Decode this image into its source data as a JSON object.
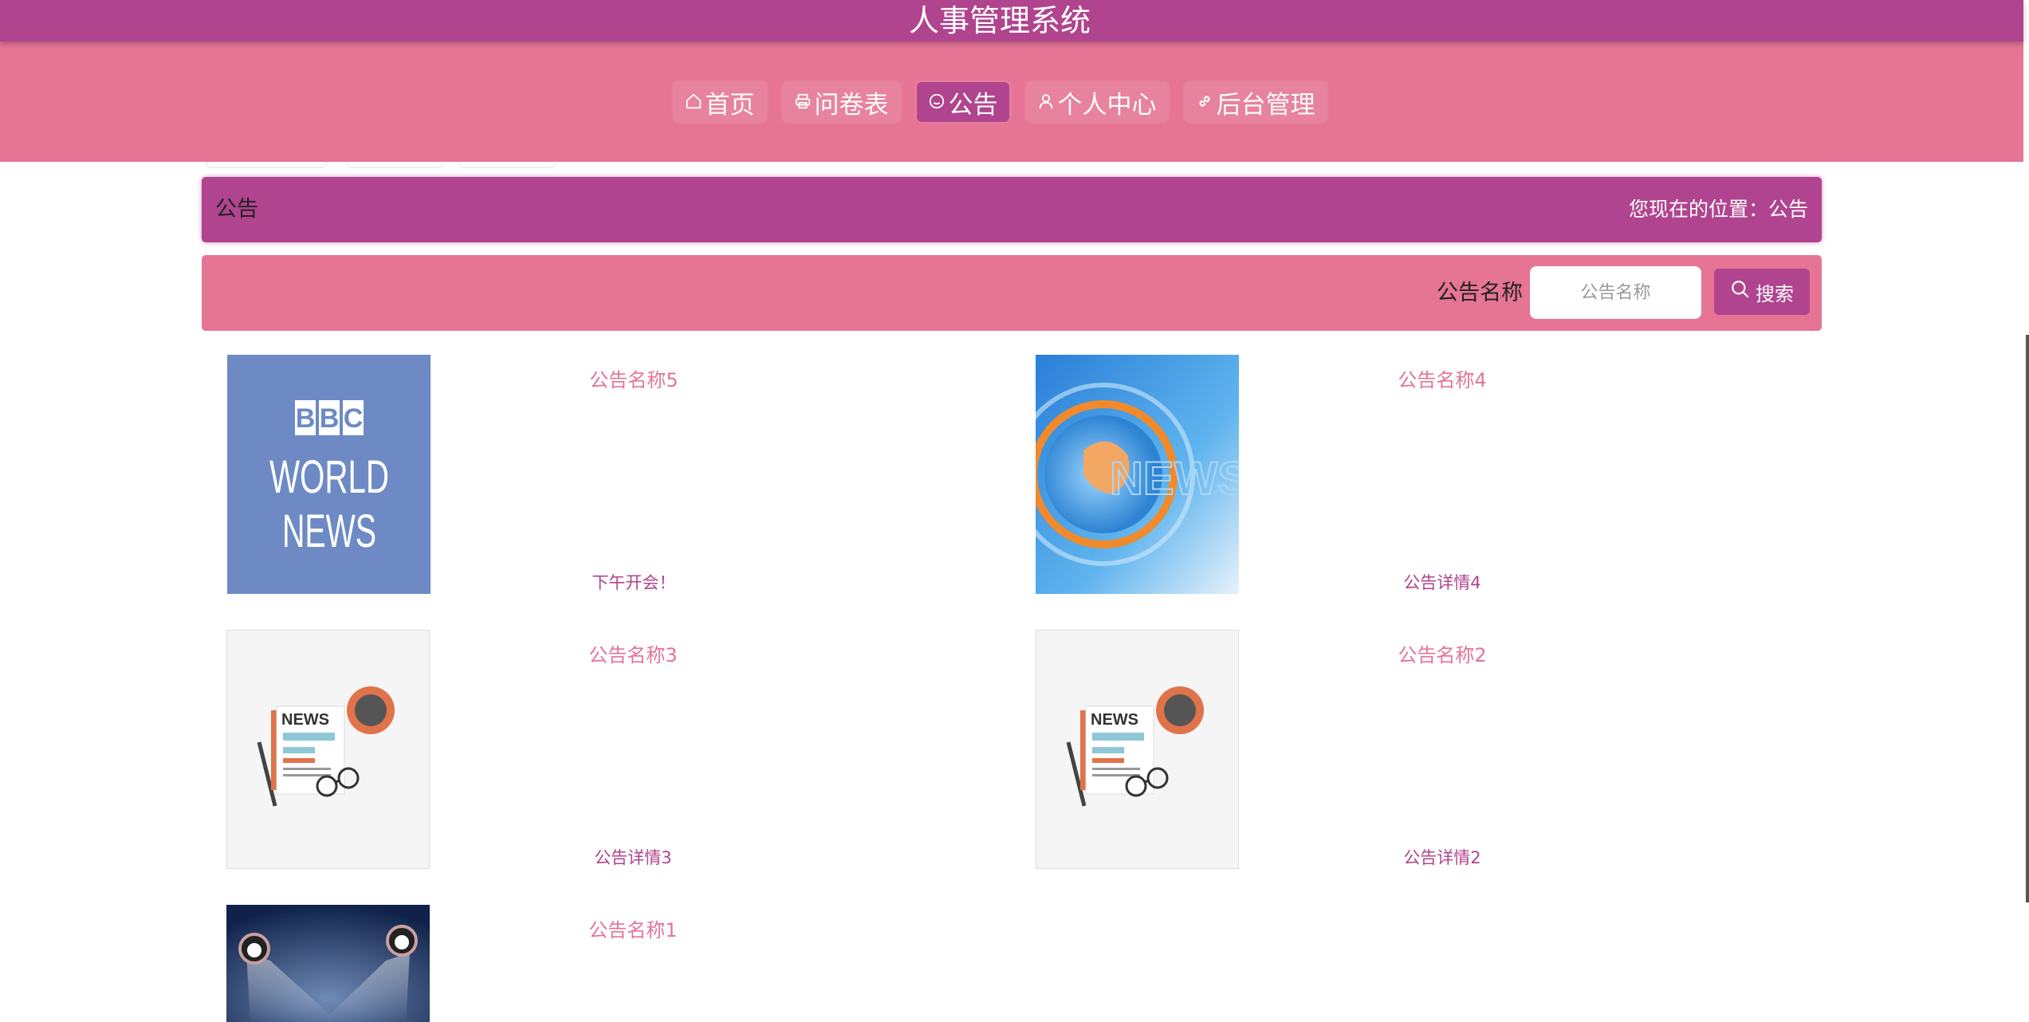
{
  "header": {
    "title": "人事管理系统"
  },
  "nav": {
    "items": [
      {
        "label": "首页",
        "icon": "home-icon",
        "active": false
      },
      {
        "label": "问卷表",
        "icon": "printer-icon",
        "active": false
      },
      {
        "label": "公告",
        "icon": "smile-icon",
        "active": true
      },
      {
        "label": "个人中心",
        "icon": "user-icon",
        "active": false
      },
      {
        "label": "后台管理",
        "icon": "link-icon",
        "active": false
      }
    ]
  },
  "breadcrumb": {
    "title": "公告",
    "location": "您现在的位置：公告"
  },
  "search": {
    "label": "公告名称",
    "placeholder": "公告名称",
    "value": "",
    "button": "搜索"
  },
  "notices": [
    {
      "name": "公告名称5",
      "detail": "下午开会！",
      "image": "bbc-world-news"
    },
    {
      "name": "公告名称4",
      "detail": "公告详情4",
      "image": "news-globe"
    },
    {
      "name": "公告名称3",
      "detail": "公告详情3",
      "image": "newspaper-illustration"
    },
    {
      "name": "公告名称2",
      "detail": "公告详情2",
      "image": "newspaper-illustration"
    },
    {
      "name": "公告名称1",
      "detail": "",
      "image": "stage-spotlights"
    }
  ],
  "colors": {
    "primary": "#b0448e",
    "secondary": "#e57495",
    "text": "#222222"
  }
}
